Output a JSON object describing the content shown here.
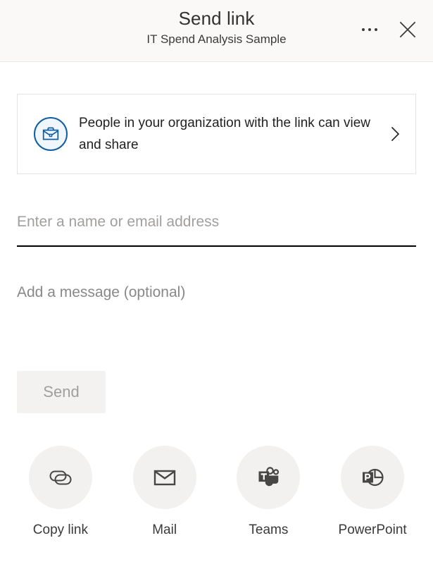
{
  "header": {
    "title": "Send link",
    "subtitle": "IT Spend Analysis Sample",
    "more_options_label": "More options",
    "close_label": "Close"
  },
  "permission": {
    "text": "People in your organization with the link can view and share",
    "icon": "briefcase-icon",
    "chevron": "chevron-right-icon",
    "accent_color": "#115ea3",
    "icon_background": "#eff6fc"
  },
  "recipients": {
    "placeholder": "Enter a name or email address",
    "value": ""
  },
  "message": {
    "placeholder": "Add a message (optional)",
    "value": ""
  },
  "send": {
    "label": "Send",
    "disabled": true
  },
  "share_options": [
    {
      "label": "Copy link",
      "icon": "link-icon"
    },
    {
      "label": "Mail",
      "icon": "envelope-icon"
    },
    {
      "label": "Teams",
      "icon": "teams-icon"
    },
    {
      "label": "PowerPoint",
      "icon": "powerpoint-icon"
    }
  ]
}
